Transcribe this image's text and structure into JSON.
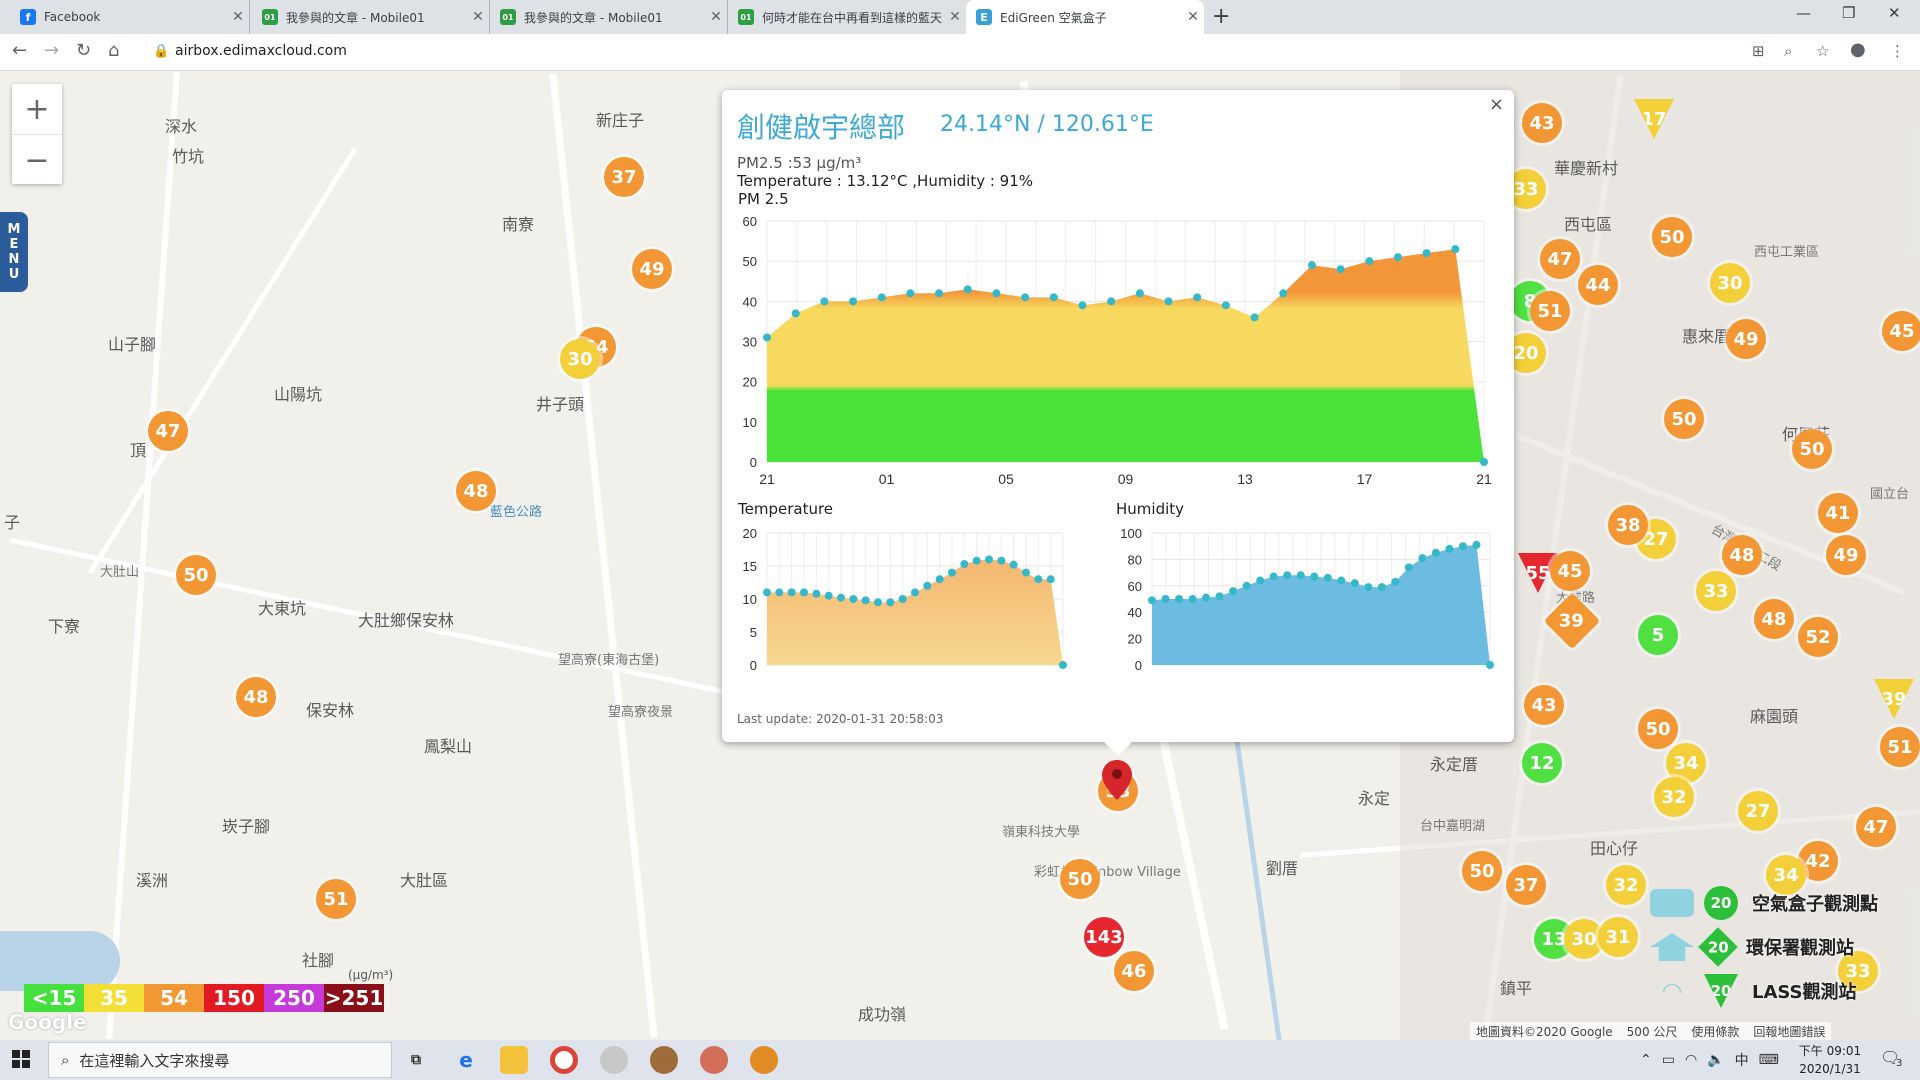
{
  "browser": {
    "tabs": [
      {
        "title": "Facebook",
        "icon_color": "#1877f2",
        "icon_glyph": "f",
        "active": false
      },
      {
        "title": "我參與的文章 - Mobile01",
        "icon_color": "#2e9e44",
        "icon_glyph": "01",
        "active": false
      },
      {
        "title": "我參與的文章 - Mobile01",
        "icon_color": "#2e9e44",
        "icon_glyph": "01",
        "active": false
      },
      {
        "title": "何時才能在台中再看到這樣的藍天",
        "icon_color": "#2e9e44",
        "icon_glyph": "01",
        "active": false
      },
      {
        "title": "EdiGreen 空氣盒子",
        "icon_color": "#3aa0d8",
        "icon_glyph": "E",
        "active": true
      }
    ],
    "url": "airbox.edimaxcloud.com"
  },
  "map": {
    "zoom_in": "+",
    "zoom_out": "−",
    "menu_letters": [
      "M",
      "E",
      "N",
      "U"
    ],
    "labels": [
      "深水",
      "竹坑",
      "新庄子",
      "南寮",
      "山子腳",
      "山陽坑",
      "井子頭",
      "頂",
      "大肚山",
      "藍色公路",
      "大肚鄉保安林",
      "大東坑",
      "下寮",
      "望高寮(東海古堡)",
      "望高寮夜景",
      "鳳梨山",
      "保安林",
      "大肚區",
      "溪洲",
      "社腳",
      "成功嶺",
      "崁子腳",
      "嶺東科技大學",
      "彩虹村-Rainbow Village",
      "劉厝",
      "永定厝",
      "永定",
      "台中嘉明湖",
      "田心仔",
      "華慶新村",
      "西屯區",
      "西屯工業區",
      "惠來厝",
      "何厝莊",
      "台灣大道二段",
      "國立台",
      "麻園頭",
      "鎮平",
      "大業路",
      "子"
    ],
    "markers": [
      "37",
      "49",
      "54",
      "30",
      "47",
      "48",
      "50",
      "48",
      "51",
      "53",
      "50",
      "143",
      "46",
      "43",
      "33",
      "17",
      "50",
      "47",
      "44",
      "8",
      "51",
      "30",
      "45",
      "49",
      "20",
      "50",
      "50",
      "41",
      "27",
      "38",
      "49",
      "48",
      "33",
      "55",
      "45",
      "39",
      "5",
      "48",
      "52",
      "43",
      "50",
      "34",
      "12",
      "32",
      "27",
      "47",
      "50",
      "37",
      "32",
      "42",
      "34",
      "13",
      "30",
      "31",
      "39",
      "51",
      "33",
      "33"
    ],
    "legend": {
      "unit": "(μg/m³)",
      "items": [
        "<15",
        "35",
        "54",
        "150",
        "250",
        ">251"
      ],
      "colors": [
        "#45e03d",
        "#f2de35",
        "#f29734",
        "#e21b22",
        "#c53ad8",
        "#8a0e17"
      ]
    },
    "google_logo": "Google",
    "stations": [
      {
        "label": "空氣盒子觀測點",
        "value": "20"
      },
      {
        "label": "環保署觀測站",
        "value": "20"
      },
      {
        "label": "LASS觀測站",
        "value": "20"
      }
    ],
    "attribution": [
      "地圖資料©2020 Google",
      "500 公尺",
      "使用條款",
      "回報地圖錯誤"
    ]
  },
  "popup": {
    "title": "創健啟宇總部",
    "coords": "24.14°N / 120.61°E",
    "pm25_line": "PM2.5 :53 μg/m³",
    "temp_hum_line": "Temperature : 13.12°C ,Humidity : 91%",
    "pm_chart_title": "PM 2.5",
    "temperature_title": "Temperature",
    "humidity_title": "Humidity",
    "last_update": "Last update: 2020-01-31 20:58:03",
    "close": "×"
  },
  "chart_data": [
    {
      "type": "area",
      "title": "PM 2.5",
      "x_tick_labels": [
        "21",
        "01",
        "05",
        "09",
        "13",
        "17",
        "21"
      ],
      "ylim": [
        0,
        60
      ],
      "y_ticks": [
        0,
        10,
        20,
        30,
        40,
        50,
        60
      ],
      "grid": true,
      "values": [
        31,
        37,
        40,
        40,
        41,
        42,
        42,
        43,
        42,
        41,
        41,
        39,
        40,
        42,
        40,
        41,
        39,
        36,
        42,
        49,
        48,
        50,
        51,
        52,
        53,
        0
      ]
    },
    {
      "type": "area",
      "title": "Temperature",
      "ylim": [
        0,
        20
      ],
      "y_ticks": [
        0,
        5,
        10,
        15,
        20
      ],
      "grid": true,
      "values": [
        11,
        11,
        11,
        11,
        10.8,
        10.5,
        10.2,
        10,
        9.8,
        9.5,
        9.5,
        10,
        11,
        12,
        13,
        14,
        15.3,
        15.8,
        16,
        15.8,
        15.2,
        14,
        13,
        13,
        0
      ]
    },
    {
      "type": "area",
      "title": "Humidity",
      "ylim": [
        0,
        100
      ],
      "y_ticks": [
        0,
        20,
        40,
        60,
        80,
        100
      ],
      "grid": true,
      "values": [
        49,
        50,
        50,
        50,
        51,
        52,
        56,
        60,
        64,
        67,
        68,
        68,
        67,
        66,
        64,
        62,
        59,
        59,
        63,
        74,
        81,
        85,
        88,
        90,
        91,
        0
      ]
    }
  ],
  "taskbar": {
    "search_placeholder": "在這裡輸入文字來搜尋",
    "clock_time": "下午 09:01",
    "clock_date": "2020/1/31",
    "ime": "中",
    "notification_count": "3"
  }
}
